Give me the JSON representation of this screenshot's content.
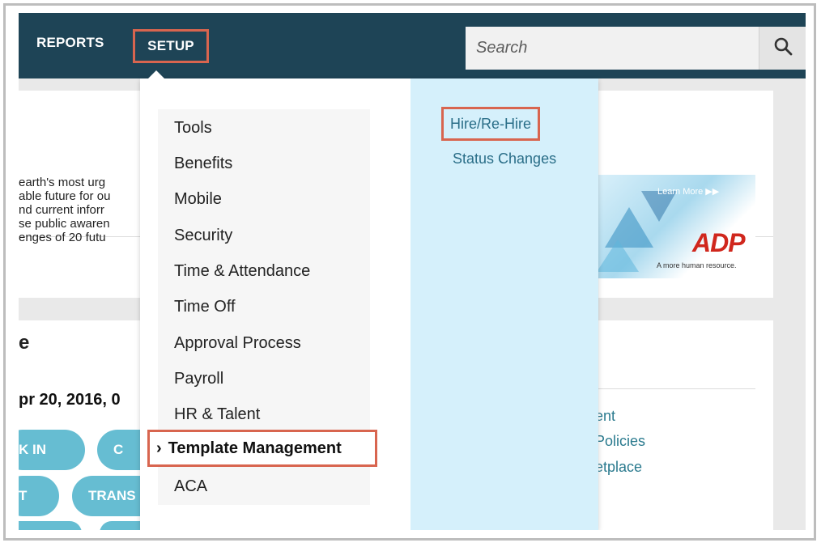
{
  "nav": {
    "reports_label": "REPORTS",
    "setup_label": "SETUP"
  },
  "search": {
    "placeholder": "Search"
  },
  "background": {
    "text_lines": [
      "earth's most urg",
      "able future for ou",
      "nd current inforr",
      "se public awaren",
      "enges of 20 futu"
    ],
    "heading_fragment": "e",
    "date_fragment": "pr 20, 2016, 0",
    "links": [
      "ent",
      "Policies",
      "etplace"
    ],
    "pills": [
      "K IN",
      "C",
      "T",
      "TRANS"
    ],
    "ad": {
      "learn_more": "Learn More ▶▶",
      "logo": "ADP",
      "tagline": "A more human resource."
    }
  },
  "menu": {
    "items": [
      {
        "label": "Tools"
      },
      {
        "label": "Benefits"
      },
      {
        "label": "Mobile"
      },
      {
        "label": "Security"
      },
      {
        "label": "Time & Attendance"
      },
      {
        "label": "Time Off"
      },
      {
        "label": "Approval Process"
      },
      {
        "label": "Payroll"
      },
      {
        "label": "HR & Talent"
      },
      {
        "label": "Template Management",
        "active": true
      },
      {
        "label": "ACA"
      }
    ],
    "active_chevron": "›",
    "submenu": [
      {
        "label": "Hire/Re-Hire",
        "highlighted": true
      },
      {
        "label": "Status Changes"
      }
    ]
  },
  "colors": {
    "topbar": "#1e4456",
    "highlight_border": "#d8654f",
    "submenu_bg": "#d5f0fb",
    "link": "#2a6e88",
    "pill": "#66bdd2"
  }
}
